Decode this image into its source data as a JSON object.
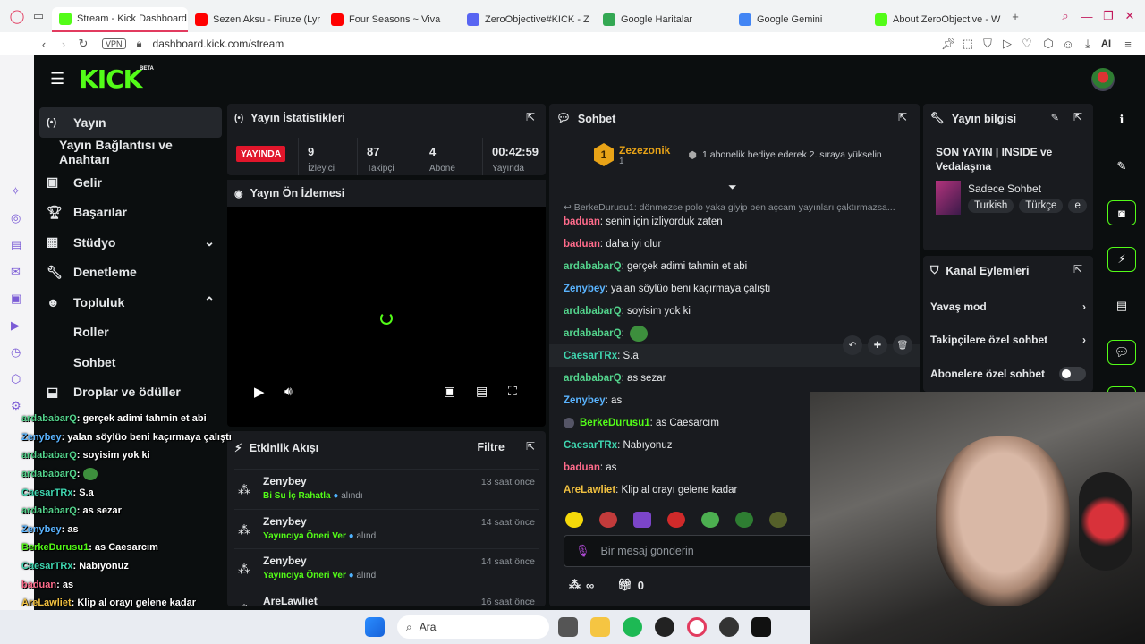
{
  "browser": {
    "tabs": [
      {
        "label": "Stream - Kick Dashboard",
        "color": "#53fc18"
      },
      {
        "label": "Sezen Aksu - Firuze (Lyr",
        "color": "#ff0000"
      },
      {
        "label": "Four Seasons ~ Viva",
        "color": "#ff0000"
      },
      {
        "label": "ZeroObjective#KICK - Z",
        "color": "#5865f2"
      },
      {
        "label": "Google Haritalar",
        "color": "#34a853"
      },
      {
        "label": "Google Gemini",
        "color": "#4285f4"
      },
      {
        "label": "About ZeroObjective - W",
        "color": "#53fc18"
      }
    ],
    "vpn": "VPN",
    "url": "dashboard.kick.com/stream",
    "ai": "AI"
  },
  "brand": {
    "logo": "KICK",
    "beta": "BETA"
  },
  "sidebar": {
    "items": [
      {
        "label": "Yayın",
        "icon": "broadcast-icon"
      },
      {
        "label": "Yayın Bağlantısı ve Anahtarı",
        "icon": ""
      },
      {
        "label": "Gelir",
        "icon": "money-icon"
      },
      {
        "label": "Başarılar",
        "icon": "trophy-icon"
      },
      {
        "label": "Stüdyo",
        "icon": "studio-icon"
      },
      {
        "label": "Denetleme",
        "icon": "wrench-icon"
      },
      {
        "label": "Topluluk",
        "icon": "community-icon"
      },
      {
        "label": "Roller",
        "icon": ""
      },
      {
        "label": "Sohbet",
        "icon": ""
      },
      {
        "label": "Droplar ve ödüller",
        "icon": "drops-icon"
      }
    ]
  },
  "stats": {
    "title": "Yayın İstatistikleri",
    "live_badge": "YAYINDA",
    "items": [
      {
        "value": "9",
        "label": "İzleyici"
      },
      {
        "value": "87",
        "label": "Takipçi"
      },
      {
        "value": "4",
        "label": "Abone"
      },
      {
        "value": "00:42:59",
        "label": "Yayında"
      }
    ]
  },
  "preview": {
    "title": "Yayın Ön İzlemesi"
  },
  "activity": {
    "title": "Etkinlik Akışı",
    "filter": "Filtre",
    "items": [
      {
        "user": "Zenybey",
        "reward": "Bi Su İç Rahatla",
        "suffix": "alındı",
        "time": "13 saat önce"
      },
      {
        "user": "Zenybey",
        "reward": "Yayıncıya Öneri Ver",
        "suffix": "alındı",
        "time": "14 saat önce"
      },
      {
        "user": "Zenybey",
        "reward": "Yayıncıya Öneri Ver",
        "suffix": "alındı",
        "time": "14 saat önce"
      },
      {
        "user": "AreLawliet",
        "reward": "",
        "suffix": "",
        "time": "16 saat önce"
      }
    ]
  },
  "chat": {
    "title": "Sohbet",
    "gift_user": "Zezezonik",
    "gift_rank": "1",
    "gift_count": "1",
    "gift_message": "1 abonelik hediye ederek 2. sıraya yükselin",
    "reply_preview": "BerkeDurusu1: dönmezse polo yaka giyip ben açcam yayınları çaktırmazsa...",
    "messages": [
      {
        "user": "baduan",
        "color": "#ff6b8b",
        "text": ": senin için izliyorduk zaten"
      },
      {
        "user": "baduan",
        "color": "#ff6b8b",
        "text": ": daha iyi olur"
      },
      {
        "user": "ardababarQ",
        "color": "#53d38c",
        "text": ": gerçek adimi tahmin et abi"
      },
      {
        "user": "Zenybey",
        "color": "#5ab4ff",
        "text": ": yalan söylüo beni kaçırmaya çalıştı"
      },
      {
        "user": "ardababarQ",
        "color": "#53d38c",
        "text": ": soyisim yok ki"
      },
      {
        "user": "ardababarQ",
        "color": "#53d38c",
        "text": ":"
      },
      {
        "user": "CaesarTRx",
        "color": "#3fd6b0",
        "text": ": S.a"
      },
      {
        "user": "ardababarQ",
        "color": "#53d38c",
        "text": ": as sezar"
      },
      {
        "user": "Zenybey",
        "color": "#5ab4ff",
        "text": ": as"
      },
      {
        "user": "BerkeDurusu1",
        "color": "#53fc18",
        "text": ": as Caesarcım"
      },
      {
        "user": "CaesarTRx",
        "color": "#3fd6b0",
        "text": ": Nabıyonuz"
      },
      {
        "user": "baduan",
        "color": "#ff6b8b",
        "text": ": as"
      },
      {
        "user": "AreLawliet",
        "color": "#f0c040",
        "text": ": Klip al orayı gelene kadar"
      }
    ],
    "input_placeholder": "Bir mesaj gönderin",
    "infinity": "∞",
    "gift_box_count": "0"
  },
  "stream_info": {
    "title": "Yayın bilgisi",
    "stream_title": "SON YAYIN | INSIDE ve Vedalaşma",
    "category": "Sadece Sohbet",
    "tags": [
      "Turkish",
      "Türkçe",
      "e"
    ]
  },
  "channel_actions": {
    "title": "Kanal Eylemleri",
    "items": [
      {
        "label": "Yavaş mod",
        "control": "arrow"
      },
      {
        "label": "Takipçilere özel sohbet",
        "control": "arrow"
      },
      {
        "label": "Abonelere özel sohbet",
        "control": "toggle"
      }
    ]
  },
  "overlay_chat": [
    {
      "user": "ardababarQ",
      "color": "#53d38c",
      "text": ": gerçek adimi tahmin et abi"
    },
    {
      "user": "Zenybey",
      "color": "#5ab4ff",
      "text": ": yalan söylüo beni kaçırmaya çalıştı"
    },
    {
      "user": "ardababarQ",
      "color": "#53d38c",
      "text": ": soyisim yok ki"
    },
    {
      "user": "ardababarQ",
      "color": "#53d38c",
      "text": ":"
    },
    {
      "user": "CaesarTRx",
      "color": "#3fd6b0",
      "text": ": S.a"
    },
    {
      "user": "ardababarQ",
      "color": "#53d38c",
      "text": ": as sezar"
    },
    {
      "user": "Zenybey",
      "color": "#5ab4ff",
      "text": ": as"
    },
    {
      "user": "BerkeDurusu1",
      "color": "#53fc18",
      "text": ": as Caesarcım"
    },
    {
      "user": "CaesarTRx",
      "color": "#3fd6b0",
      "text": ": Nabıyonuz"
    },
    {
      "user": "baduan",
      "color": "#ff6b8b",
      "text": ": as"
    },
    {
      "user": "AreLawliet",
      "color": "#f0c040",
      "text": ": Klip al orayı gelene kadar"
    }
  ],
  "taskbar": {
    "search": "Ara"
  },
  "colors": {
    "accent": "#53fc18",
    "live": "#e1162b",
    "panel": "#191b1f",
    "bg": "#0b0e0f"
  }
}
